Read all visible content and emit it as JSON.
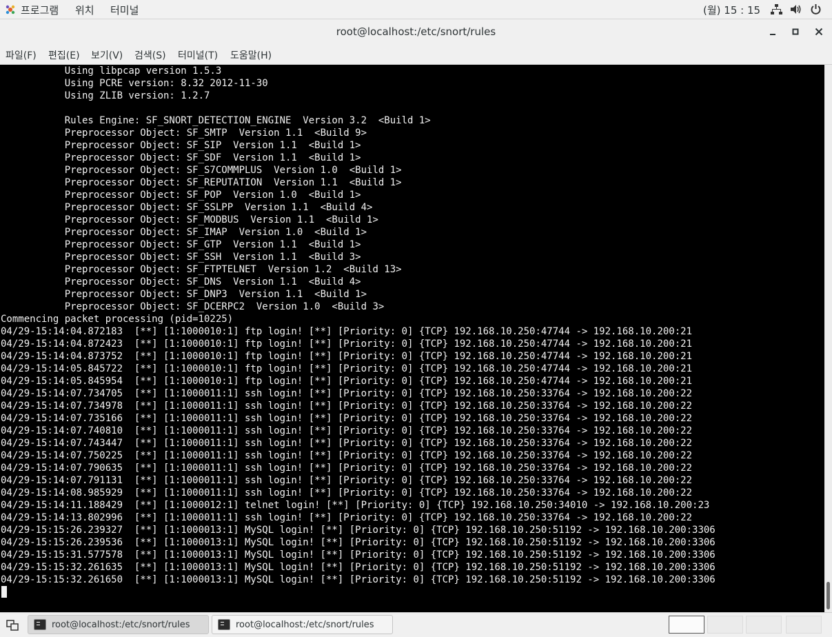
{
  "top_bar": {
    "menus": [
      "프로그램",
      "위치",
      "터미널"
    ],
    "clock": "(월) 15 : 15",
    "icons": [
      "network-icon",
      "volume-icon",
      "power-icon"
    ]
  },
  "window": {
    "title": "root@localhost:/etc/snort/rules",
    "buttons": [
      "minimize-icon",
      "maximize-icon",
      "close-icon"
    ]
  },
  "menu_bar": {
    "items": [
      "파일(F)",
      "편집(E)",
      "보기(V)",
      "검색(S)",
      "터미널(T)",
      "도움말(H)"
    ]
  },
  "terminal": {
    "lines": [
      "           Using libpcap version 1.5.3",
      "           Using PCRE version: 8.32 2012-11-30",
      "           Using ZLIB version: 1.2.7",
      "",
      "           Rules Engine: SF_SNORT_DETECTION_ENGINE  Version 3.2  <Build 1>",
      "           Preprocessor Object: SF_SMTP  Version 1.1  <Build 9>",
      "           Preprocessor Object: SF_SIP  Version 1.1  <Build 1>",
      "           Preprocessor Object: SF_SDF  Version 1.1  <Build 1>",
      "           Preprocessor Object: SF_S7COMMPLUS  Version 1.0  <Build 1>",
      "           Preprocessor Object: SF_REPUTATION  Version 1.1  <Build 1>",
      "           Preprocessor Object: SF_POP  Version 1.0  <Build 1>",
      "           Preprocessor Object: SF_SSLPP  Version 1.1  <Build 4>",
      "           Preprocessor Object: SF_MODBUS  Version 1.1  <Build 1>",
      "           Preprocessor Object: SF_IMAP  Version 1.0  <Build 1>",
      "           Preprocessor Object: SF_GTP  Version 1.1  <Build 1>",
      "           Preprocessor Object: SF_SSH  Version 1.1  <Build 3>",
      "           Preprocessor Object: SF_FTPTELNET  Version 1.2  <Build 13>",
      "           Preprocessor Object: SF_DNS  Version 1.1  <Build 4>",
      "           Preprocessor Object: SF_DNP3  Version 1.1  <Build 1>",
      "           Preprocessor Object: SF_DCERPC2  Version 1.0  <Build 3>",
      "Commencing packet processing (pid=10225)",
      "04/29-15:14:04.872183  [**] [1:1000010:1] ftp login! [**] [Priority: 0] {TCP} 192.168.10.250:47744 -> 192.168.10.200:21",
      "04/29-15:14:04.872423  [**] [1:1000010:1] ftp login! [**] [Priority: 0] {TCP} 192.168.10.250:47744 -> 192.168.10.200:21",
      "04/29-15:14:04.873752  [**] [1:1000010:1] ftp login! [**] [Priority: 0] {TCP} 192.168.10.250:47744 -> 192.168.10.200:21",
      "04/29-15:14:05.845722  [**] [1:1000010:1] ftp login! [**] [Priority: 0] {TCP} 192.168.10.250:47744 -> 192.168.10.200:21",
      "04/29-15:14:05.845954  [**] [1:1000010:1] ftp login! [**] [Priority: 0] {TCP} 192.168.10.250:47744 -> 192.168.10.200:21",
      "04/29-15:14:07.734705  [**] [1:1000011:1] ssh login! [**] [Priority: 0] {TCP} 192.168.10.250:33764 -> 192.168.10.200:22",
      "04/29-15:14:07.734978  [**] [1:1000011:1] ssh login! [**] [Priority: 0] {TCP} 192.168.10.250:33764 -> 192.168.10.200:22",
      "04/29-15:14:07.735166  [**] [1:1000011:1] ssh login! [**] [Priority: 0] {TCP} 192.168.10.250:33764 -> 192.168.10.200:22",
      "04/29-15:14:07.740810  [**] [1:1000011:1] ssh login! [**] [Priority: 0] {TCP} 192.168.10.250:33764 -> 192.168.10.200:22",
      "04/29-15:14:07.743447  [**] [1:1000011:1] ssh login! [**] [Priority: 0] {TCP} 192.168.10.250:33764 -> 192.168.10.200:22",
      "04/29-15:14:07.750225  [**] [1:1000011:1] ssh login! [**] [Priority: 0] {TCP} 192.168.10.250:33764 -> 192.168.10.200:22",
      "04/29-15:14:07.790635  [**] [1:1000011:1] ssh login! [**] [Priority: 0] {TCP} 192.168.10.250:33764 -> 192.168.10.200:22",
      "04/29-15:14:07.791131  [**] [1:1000011:1] ssh login! [**] [Priority: 0] {TCP} 192.168.10.250:33764 -> 192.168.10.200:22",
      "04/29-15:14:08.985929  [**] [1:1000011:1] ssh login! [**] [Priority: 0] {TCP} 192.168.10.250:33764 -> 192.168.10.200:22",
      "04/29-15:14:11.188429  [**] [1:1000012:1] telnet login! [**] [Priority: 0] {TCP} 192.168.10.250:34010 -> 192.168.10.200:23",
      "04/29-15:14:13.802996  [**] [1:1000011:1] ssh login! [**] [Priority: 0] {TCP} 192.168.10.250:33764 -> 192.168.10.200:22",
      "04/29-15:15:26.239327  [**] [1:1000013:1] MySQL login! [**] [Priority: 0] {TCP} 192.168.10.250:51192 -> 192.168.10.200:3306",
      "04/29-15:15:26.239536  [**] [1:1000013:1] MySQL login! [**] [Priority: 0] {TCP} 192.168.10.250:51192 -> 192.168.10.200:3306",
      "04/29-15:15:31.577578  [**] [1:1000013:1] MySQL login! [**] [Priority: 0] {TCP} 192.168.10.250:51192 -> 192.168.10.200:3306",
      "04/29-15:15:32.261635  [**] [1:1000013:1] MySQL login! [**] [Priority: 0] {TCP} 192.168.10.250:51192 -> 192.168.10.200:3306",
      "04/29-15:15:32.261650  [**] [1:1000013:1] MySQL login! [**] [Priority: 0] {TCP} 192.168.10.250:51192 -> 192.168.10.200:3306"
    ]
  },
  "taskbar": {
    "tasks": [
      "root@localhost:/etc/snort/rules",
      "root@localhost:/etc/snort/rules"
    ],
    "workspaces": 4,
    "active_workspace": 1
  },
  "colors": {
    "terminal_bg": "#000000",
    "terminal_fg": "#f2f2f2",
    "chrome_bg": "#f0f0f0"
  }
}
